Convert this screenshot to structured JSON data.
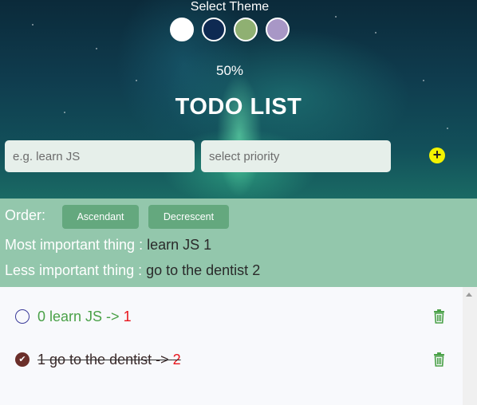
{
  "theme": {
    "title": "Select Theme",
    "swatches": [
      {
        "name": "white",
        "color": "#ffffff"
      },
      {
        "name": "navy",
        "color": "#0e2a52"
      },
      {
        "name": "green",
        "color": "#8fb072"
      },
      {
        "name": "lavender",
        "color": "#a897c6"
      }
    ]
  },
  "progress": {
    "text": "50%",
    "value": 0.5
  },
  "title": "TODO LIST",
  "inputs": {
    "task_placeholder": "e.g. learn JS",
    "priority_placeholder": "select priority",
    "add_icon": "+"
  },
  "summary": {
    "order_label": "Order:",
    "ascendant": "Ascendant",
    "decrescent": "Decrescent",
    "most_label": "Most important thing :",
    "most_value": " learn JS 1",
    "less_label": "Less important thing :",
    "less_value": " go to the dentist 2"
  },
  "todos": [
    {
      "text": "0 learn JS -> ",
      "priority": "1",
      "done": false
    },
    {
      "text": "1 go to the dentist  -> ",
      "priority": "2",
      "done": true
    }
  ],
  "colors": {
    "accent_green": "#4aa148",
    "priority_red": "#e8141c",
    "summary_bg": "#93c7ac",
    "button_bg": "#64a87e",
    "add_button": "#f3f300"
  }
}
